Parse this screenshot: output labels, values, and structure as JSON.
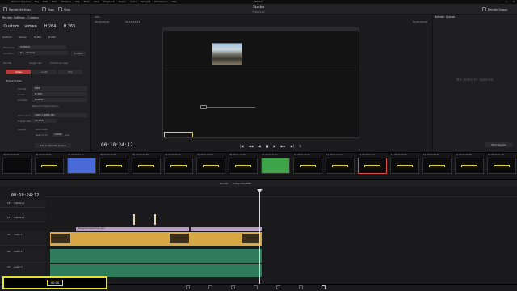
{
  "titlebar": {
    "menus": [
      "DaVinci Resolve",
      "File",
      "Edit",
      "Trim",
      "Timeline",
      "Clip",
      "Mark",
      "View",
      "Playback",
      "Fusion",
      "Color",
      "Fairlight",
      "Workspace",
      "Help"
    ],
    "title": "Studio"
  },
  "toolbar": {
    "render_settings": "Render Settings",
    "tape": "Tape",
    "clips": "Clips",
    "project": "Studio",
    "timeline_name": "Timeline 1",
    "render_queue": "Render Queue"
  },
  "left_panel": {
    "title": "Render Settings - Custom",
    "tabs": [
      "Custom",
      "Vimeo",
      "H.264",
      "H.265"
    ],
    "presets": [
      {
        "big": "Custom",
        "small": ""
      },
      {
        "big": "vimeo",
        "small": ""
      },
      {
        "big": "H.264",
        "small": ""
      },
      {
        "big": "H.265",
        "small": ""
      }
    ],
    "filename_label": "Filename",
    "filename_value": "Untitled",
    "location_label": "Location",
    "location_value": "D:\\...\\Videos",
    "browse": "Browse",
    "render_label": "Render",
    "single_clip": "Single clip",
    "individual_clips": "Individual clips",
    "export_tabs": [
      "Video",
      "Audio",
      "File"
    ],
    "export_video": "Export Video",
    "format_label": "Format",
    "format_value": "MP4",
    "codec_label": "Codec",
    "codec_value": "H.264",
    "encoder_label": "Encoder",
    "encoder_value": "Native",
    "network_opt": "Network Optimization",
    "resolution_label": "Resolution",
    "resolution_value": "1920 x 1080 HD",
    "framerate_label": "Frame rate",
    "framerate_value": "23.976",
    "quality_label": "Quality",
    "quality_auto": "Automatic",
    "quality_restrict": "Restrict to",
    "quality_value": "10000",
    "quality_unit": "Kb/s",
    "add_to_queue": "Add to Render Queue"
  },
  "viewer": {
    "zoom": "29%",
    "timecode_top_left": "00:00:00:00",
    "timecode_top_center": "00:10:24:12",
    "timecode_top_right": "00:25:00:00",
    "playhead_tc": "00:10:24:12",
    "transport": [
      "|◀",
      "◀◀",
      "◀",
      "■",
      "▶",
      "▶▶",
      "▶|",
      "↻"
    ]
  },
  "render_queue": {
    "title": "Render Queue",
    "empty": "No jobs in queue",
    "start_render": "Start Render"
  },
  "clips": [
    {
      "n": "01",
      "tc": "00:00:00:00",
      "type": "dark"
    },
    {
      "n": "02",
      "tc": "00:00:10:01",
      "type": "dark"
    },
    {
      "n": "03",
      "tc": "00:00:22:17",
      "type": "blue"
    },
    {
      "n": "04",
      "tc": "00:00:32:09",
      "type": "dark"
    },
    {
      "n": "05",
      "tc": "00:00:44:20",
      "type": "dark"
    },
    {
      "n": "06",
      "tc": "00:00:58:12",
      "type": "dark"
    },
    {
      "n": "07",
      "tc": "00:01:06:04",
      "type": "dark"
    },
    {
      "n": "08",
      "tc": "00:01:17:00",
      "type": "dark"
    },
    {
      "n": "09",
      "tc": "00:01:31:07",
      "type": "green"
    },
    {
      "n": "10",
      "tc": "00:01:42:15",
      "type": "dark"
    },
    {
      "n": "11",
      "tc": "00:01:58:03",
      "type": "dark"
    },
    {
      "n": "12",
      "tc": "00:02:07:11",
      "type": "sel"
    },
    {
      "n": "13",
      "tc": "00:02:18:00",
      "type": "dark"
    },
    {
      "n": "14",
      "tc": "00:02:29:22",
      "type": "dark"
    },
    {
      "n": "15",
      "tc": "00:02:40:06",
      "type": "dark"
    },
    {
      "n": "16",
      "tc": "00:02:51:19",
      "type": "dark"
    }
  ],
  "timeline": {
    "timecode": "00:10:24:12",
    "render_label": "Render",
    "entire_timeline": "Entire Timeline",
    "tracks": [
      {
        "id": "ST2",
        "name": "Subtitle 2"
      },
      {
        "id": "ST1",
        "name": "Subtitle 1"
      },
      {
        "id": "V1",
        "name": "Video 1"
      },
      {
        "id": "A1",
        "name": "Audio 1"
      },
      {
        "id": "A2",
        "name": "Audio 2"
      }
    ],
    "title_clip": "Background-painting.mp4",
    "highlight_label": "00:00"
  }
}
